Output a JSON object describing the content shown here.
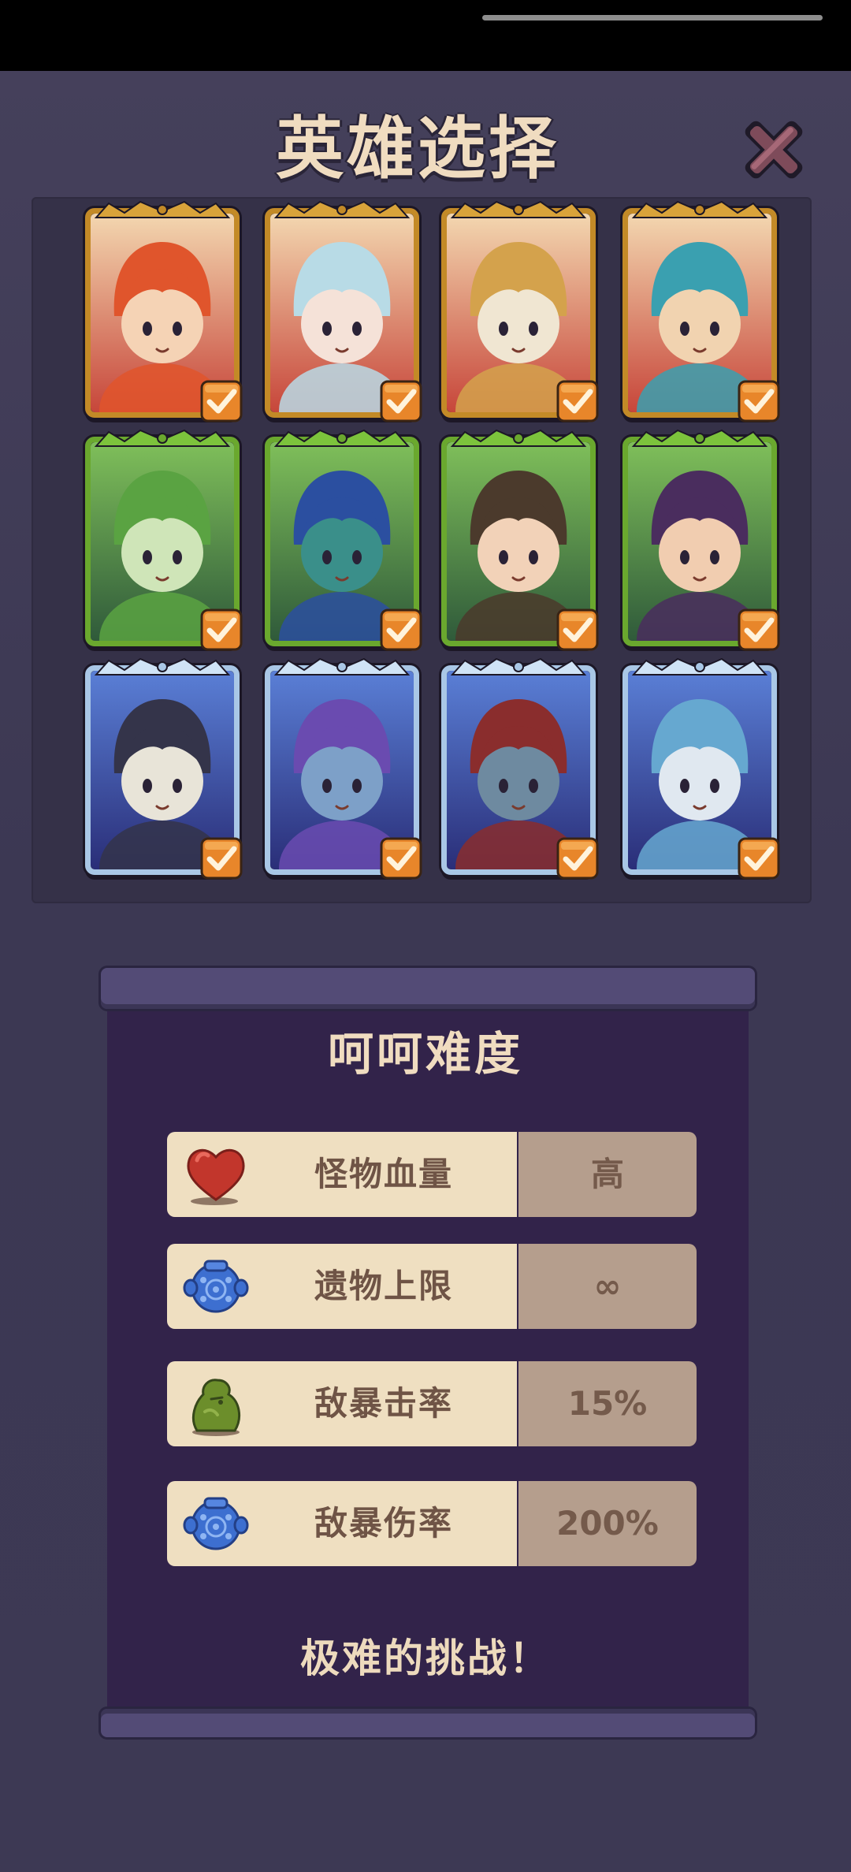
{
  "header": {
    "title": "英雄选择"
  },
  "heroes": [
    {
      "name": "red-hair-hero",
      "tier": "gold",
      "selected": true
    },
    {
      "name": "angel-girl-hero",
      "tier": "gold",
      "selected": true
    },
    {
      "name": "knight-helmet-hero",
      "tier": "gold",
      "selected": true
    },
    {
      "name": "blue-spiky-hero",
      "tier": "gold",
      "selected": true
    },
    {
      "name": "green-elf-hero",
      "tier": "green",
      "selected": true
    },
    {
      "name": "top-hat-hero",
      "tier": "green",
      "selected": true
    },
    {
      "name": "leaf-hair-hero",
      "tier": "green",
      "selected": true
    },
    {
      "name": "purple-masked-hero",
      "tier": "green",
      "selected": true
    },
    {
      "name": "skeleton-samurai-hero",
      "tier": "ice",
      "selected": true
    },
    {
      "name": "purple-crystal-hero",
      "tier": "ice",
      "selected": true
    },
    {
      "name": "crowned-zombie-hero",
      "tier": "ice",
      "selected": true
    },
    {
      "name": "blue-ghost-hero",
      "tier": "ice",
      "selected": true
    }
  ],
  "difficulty": {
    "title": "呵呵难度",
    "rows": [
      {
        "label": "怪物血量",
        "value": "高",
        "icon": "heart-icon"
      },
      {
        "label": "遗物上限",
        "value": "∞",
        "icon": "blue-jar-icon"
      },
      {
        "label": "敌暴击率",
        "value": "15%",
        "icon": "green-blob-icon"
      },
      {
        "label": "敌暴伤率",
        "value": "200%",
        "icon": "blue-jar-icon"
      }
    ],
    "footer": "极难的挑战！"
  },
  "colors": {
    "background": "#3f3b55",
    "title_text": "#f0dcc0",
    "difficulty_panel": "#32234a",
    "label_box": "#efdfc1",
    "value_box": "#b59e8d",
    "check_orange": "#e8862a"
  }
}
